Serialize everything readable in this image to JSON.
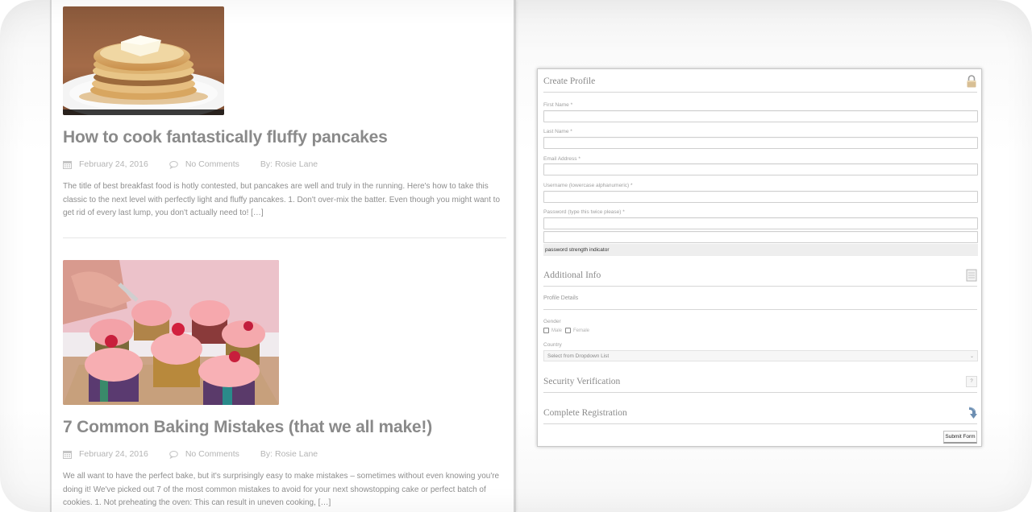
{
  "posts": [
    {
      "image_alt": "Stack of fluffy pancakes with butter and syrup",
      "title": "How to cook fantastically fluffy pancakes",
      "date": "February 24, 2016",
      "comments": "No Comments",
      "author": "By: Rosie Lane",
      "excerpt": "The title of best breakfast food is hotly contested, but pancakes are well and truly in the running. Here's how to take this classic to the next level with perfectly light and fluffy pancakes. 1. Don't over-mix the batter. Even though you might want to get rid of every last lump, you don't actually need to! […]"
    },
    {
      "image_alt": "Cupcakes with pink frosting and raspberries being decorated",
      "title": "7 Common Baking Mistakes (that we all make!)",
      "date": "February 24, 2016",
      "comments": "No Comments",
      "author": "By: Rosie Lane",
      "excerpt": "We all want to have the perfect bake, but it's surprisingly easy to make mistakes – sometimes without even knowing you're doing it! We've picked out 7 of the most common mistakes to avoid for your next showstopping cake or perfect batch of cookies. 1. Not preheating the oven: This can result in uneven cooking, […]"
    }
  ],
  "form": {
    "create_profile": {
      "title": "Create Profile",
      "icon": "lock-icon",
      "fields": [
        {
          "label": "First Name *",
          "value": "",
          "placeholder": ""
        },
        {
          "label": "Last Name *",
          "value": "",
          "placeholder": ""
        },
        {
          "label": "Email Address *",
          "value": "",
          "placeholder": ""
        },
        {
          "label": "Username (lowercase alphanumeric) *",
          "value": "",
          "placeholder": ""
        },
        {
          "label": "Password (type this twice please) *",
          "value": "",
          "placeholder": ""
        }
      ],
      "password_confirm_value": "",
      "strength_indicator": "password strength indicator"
    },
    "additional_info": {
      "title": "Additional Info",
      "icon": "document-icon",
      "subsection": "Profile Details",
      "gender_label": "Gender",
      "gender_options": [
        "Male",
        "Female"
      ],
      "country_label": "Country",
      "country_selected": "Select from Dropdown List"
    },
    "security": {
      "title": "Security Verification",
      "icon": "question-icon",
      "icon_glyph": "?"
    },
    "complete": {
      "title": "Complete Registration",
      "icon": "arrow-down-icon",
      "submit_label": "Submit Form"
    }
  }
}
